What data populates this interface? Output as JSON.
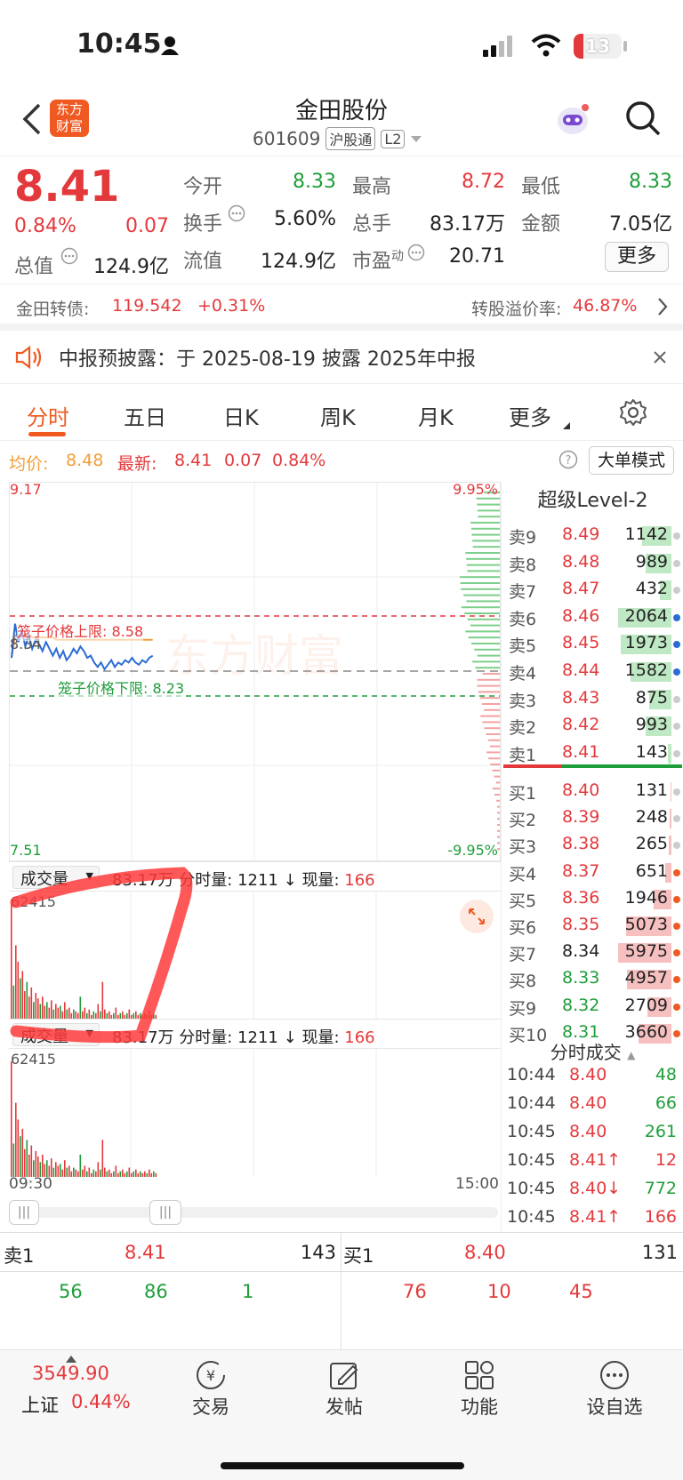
{
  "status": {
    "time": "10:45",
    "battery": "13"
  },
  "nav": {
    "title": "金田股份",
    "code": "601609",
    "tag1": "沪股通",
    "tag2": "L2",
    "logo_top": "东方",
    "logo_bottom": "财富"
  },
  "quote": {
    "price": "8.41",
    "pct": "0.84%",
    "chg": "0.07",
    "open_label": "今开",
    "open": "8.33",
    "high_label": "最高",
    "high": "8.72",
    "low_label": "最低",
    "low": "8.33",
    "turnover_label": "换手",
    "turnover": "5.60%",
    "vol_label": "总手",
    "vol": "83.17万",
    "amount_label": "金额",
    "amount": "7.05亿",
    "mcap_label": "总值",
    "mcap": "124.9亿",
    "float_label": "流值",
    "float": "124.9亿",
    "pe_label": "市盈",
    "pe_sup": "动",
    "pe": "20.71",
    "more_label": "更多"
  },
  "bond": {
    "name": "金田转债:",
    "price": "119.542",
    "pct": "+0.31%",
    "premium_label": "转股溢价率:",
    "premium": "46.87%"
  },
  "notice": {
    "text": "中报预披露：于 2025-08-19 披露 2025年中报"
  },
  "tabs": [
    "分时",
    "五日",
    "日K",
    "周K",
    "月K",
    "更多"
  ],
  "indicators": {
    "avg_label": "均价:",
    "avg": "8.48",
    "latest_label": "最新:",
    "latest": "8.41",
    "chg": "0.07",
    "pct": "0.84%",
    "mode_label": "大单模式"
  },
  "chart": {
    "max_price": "9.17",
    "max_pct": "9.95%",
    "min_price": "7.51",
    "min_pct": "-9.95%",
    "prev_close": "8.34",
    "cage_upper_label": "笼子价格上限:",
    "cage_upper": "8.58",
    "cage_lower_label": "笼子价格下限:",
    "cage_lower": "8.23",
    "watermark": "东方财富",
    "price_line": [
      8.4,
      8.55,
      8.47,
      8.52,
      8.45,
      8.5,
      8.44,
      8.48,
      8.46,
      8.43,
      8.47,
      8.44,
      8.41,
      8.44,
      8.4,
      8.43,
      8.39,
      8.41,
      8.44,
      8.42,
      8.45,
      8.43,
      8.4,
      8.41,
      8.38,
      8.36,
      8.38,
      8.35,
      8.37,
      8.39,
      8.36,
      8.38,
      8.37,
      8.39,
      8.38,
      8.4,
      8.38,
      8.37,
      8.39,
      8.38,
      8.4,
      8.41
    ],
    "avg_line": [
      8.4,
      8.5,
      8.5,
      8.5,
      8.5,
      8.5,
      8.49,
      8.49,
      8.49,
      8.49,
      8.49,
      8.49,
      8.49,
      8.48,
      8.48,
      8.48,
      8.48,
      8.48,
      8.48,
      8.48,
      8.48,
      8.48,
      8.48,
      8.48,
      8.48,
      8.48,
      8.48,
      8.48,
      8.48,
      8.48,
      8.48,
      8.48,
      8.48,
      8.48,
      8.48,
      8.48,
      8.48,
      8.48,
      8.48,
      8.48,
      8.48,
      8.48
    ]
  },
  "volume": {
    "selector": "成交量",
    "total": "83.17万",
    "minute_label": "分时量:",
    "minute": "1211",
    "arrow": "↓",
    "current_label": "现量:",
    "current": "166",
    "max": "62415",
    "bars": [
      62415,
      18000,
      40000,
      31000,
      22000,
      26000,
      15000,
      20000,
      12000,
      17000,
      9000,
      14000,
      11000,
      8000,
      12000,
      7000,
      9000,
      6000,
      10000,
      5000,
      8000,
      6000,
      7000,
      4000,
      9000,
      5000,
      6000,
      3000,
      5000,
      4000,
      3000,
      12000,
      4000,
      6000,
      3000,
      5000,
      2000,
      4000,
      3000,
      8000,
      4000,
      20000,
      5000,
      3000,
      4000,
      2000,
      3000,
      6000,
      2000,
      3000,
      4000,
      2000,
      3000,
      5000,
      2000,
      3000,
      4000,
      2000,
      3000,
      2000,
      3000,
      2000,
      4000,
      2000,
      3000,
      2000
    ],
    "time_start": "09:30",
    "time_end": "15:00"
  },
  "orderbook": {
    "title": "超级Level-2",
    "sells": [
      {
        "label": "卖9",
        "price": "8.49",
        "vol": "1142"
      },
      {
        "label": "卖8",
        "price": "8.48",
        "vol": "989"
      },
      {
        "label": "卖7",
        "price": "8.47",
        "vol": "432"
      },
      {
        "label": "卖6",
        "price": "8.46",
        "vol": "2064"
      },
      {
        "label": "卖5",
        "price": "8.45",
        "vol": "1973"
      },
      {
        "label": "卖4",
        "price": "8.44",
        "vol": "1582"
      },
      {
        "label": "卖3",
        "price": "8.43",
        "vol": "875"
      },
      {
        "label": "卖2",
        "price": "8.42",
        "vol": "993"
      },
      {
        "label": "卖1",
        "price": "8.41",
        "vol": "143"
      }
    ],
    "buys": [
      {
        "label": "买1",
        "price": "8.40",
        "vol": "131"
      },
      {
        "label": "买2",
        "price": "8.39",
        "vol": "248"
      },
      {
        "label": "买3",
        "price": "8.38",
        "vol": "265"
      },
      {
        "label": "买4",
        "price": "8.37",
        "vol": "651"
      },
      {
        "label": "买5",
        "price": "8.36",
        "vol": "1946"
      },
      {
        "label": "买6",
        "price": "8.35",
        "vol": "5073"
      },
      {
        "label": "买7",
        "price": "8.34",
        "vol": "5975"
      },
      {
        "label": "买8",
        "price": "8.33",
        "vol": "4957"
      },
      {
        "label": "买9",
        "price": "8.32",
        "vol": "2709"
      },
      {
        "label": "买10",
        "price": "8.31",
        "vol": "3660"
      }
    ]
  },
  "ticks": {
    "title": "分时成交",
    "rows": [
      {
        "time": "10:44",
        "price": "8.40",
        "vol": "48"
      },
      {
        "time": "10:44",
        "price": "8.40",
        "vol": "66"
      },
      {
        "time": "10:45",
        "price": "8.40",
        "vol": "261"
      },
      {
        "time": "10:45",
        "price": "8.41↑",
        "vol": "12"
      },
      {
        "time": "10:45",
        "price": "8.40↓",
        "vol": "772"
      },
      {
        "time": "10:45",
        "price": "8.41↑",
        "vol": "166"
      }
    ]
  },
  "bidask": {
    "sell_label": "卖1",
    "sell_price": "8.41",
    "sell_vol": "143",
    "buy_label": "买1",
    "buy_price": "8.40",
    "buy_vol": "131",
    "sell_queue": [
      "56",
      "86",
      "1"
    ],
    "buy_queue": [
      "76",
      "10",
      "45"
    ]
  },
  "bottom": {
    "index_value": "3549.90",
    "index_name": "上证",
    "index_pct": "0.44%",
    "trade": "交易",
    "post": "发帖",
    "func": "功能",
    "watch": "设自选"
  }
}
